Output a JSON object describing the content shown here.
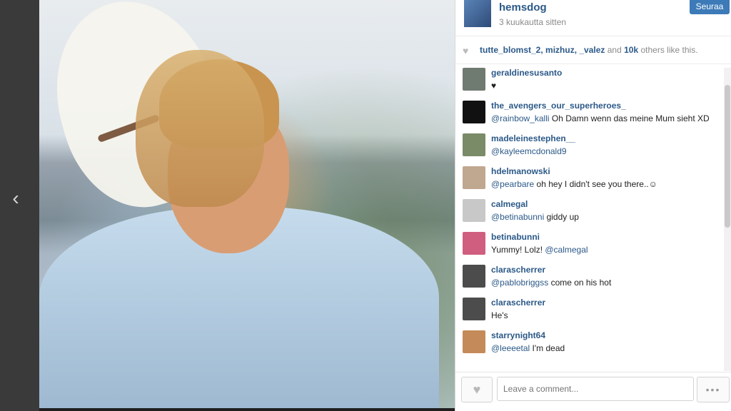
{
  "navigation": {
    "back_icon": "chevron-left-icon",
    "back_glyph": "‹"
  },
  "post": {
    "username": "hemsdog",
    "time": "3 kuukautta sitten",
    "follow_label": "Seuraa"
  },
  "likes": {
    "icon": "heart-icon",
    "likers": [
      "tutte_blomst_2",
      "mizhuz",
      "_valez"
    ],
    "and": "and",
    "count": "10k",
    "suffix": "others like this."
  },
  "comments": [
    {
      "user": "geraldinesusanto",
      "text": "♥",
      "avatar_color": "#6f7a70"
    },
    {
      "user": "the_avengers_our_superheroes_",
      "mention": "@rainbow_kalli",
      "text": " Oh Damn wenn das meine Mum sieht XD",
      "avatar_color": "#111111"
    },
    {
      "user": "madeleinestephen__",
      "mention": "@kayleemcdonald9",
      "text": "",
      "avatar_color": "#7a8b68"
    },
    {
      "user": "hdelmanowski",
      "mention": "@pearbare",
      "text": " oh hey I didn't see you there..☺",
      "avatar_color": "#c0a78f"
    },
    {
      "user": "calmegal",
      "mention": "@betinabunni",
      "text": " giddy up",
      "avatar_color": "#c8c8c8"
    },
    {
      "user": "betinabunni",
      "text": "Yummy! Lolz! ",
      "mention2": "@calmegal",
      "avatar_color": "#d05e7f"
    },
    {
      "user": "clarascherrer",
      "mention": "@pablobriggss",
      "text": " come on his hot",
      "avatar_color": "#4c4c4c"
    },
    {
      "user": "clarascherrer",
      "text": "He's",
      "avatar_color": "#4c4c4c"
    },
    {
      "user": "starrynight64",
      "mention": "@leeeetal",
      "text": " I'm dead",
      "avatar_color": "#c58a59"
    }
  ],
  "footer": {
    "heart_icon": "heart-icon",
    "comment_placeholder": "Leave a comment...",
    "more_icon": "ellipsis-icon",
    "more_glyph": "•••"
  }
}
